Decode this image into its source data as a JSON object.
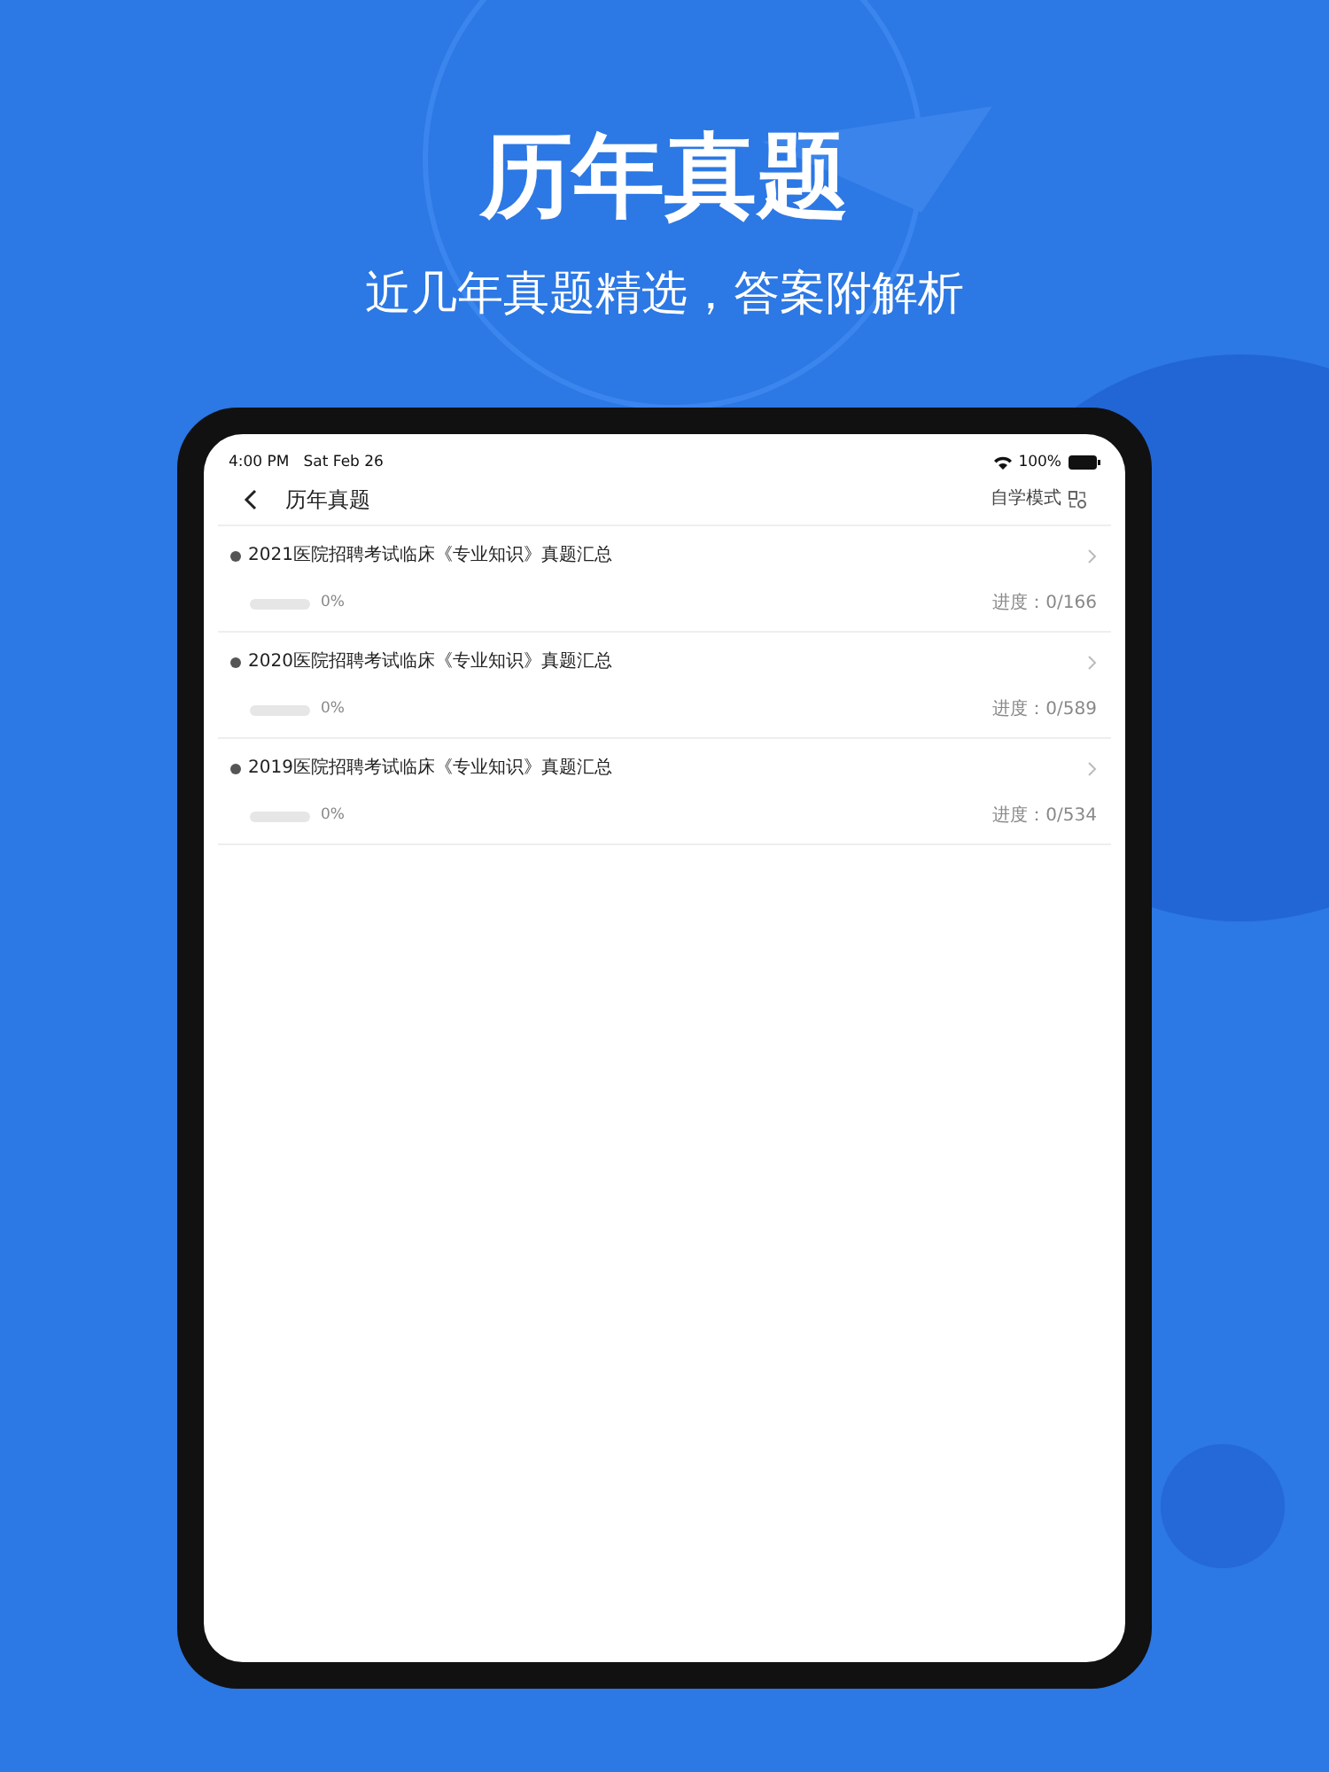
{
  "headline": "历年真题",
  "subtitle": "近几年真题精选，答案附解析",
  "status_bar": {
    "time": "4:00 PM",
    "date": "Sat Feb 26",
    "battery": "100%"
  },
  "nav": {
    "title": "历年真题",
    "mode": "自学模式"
  },
  "papers": [
    {
      "title": "2021医院招聘考试临床《专业知识》真题汇总",
      "level": 0,
      "percent": "0%",
      "progress": "进度：0/166"
    },
    {
      "title": "2020医院招聘考试临床《专业知识》真题汇总",
      "level": 0,
      "percent": "0%",
      "progress": "进度：0/589"
    },
    {
      "title": "2019医院招聘考试临床《专业知识》真题汇总",
      "level": 0,
      "percent": "0%",
      "progress": "进度：0/534"
    }
  ]
}
